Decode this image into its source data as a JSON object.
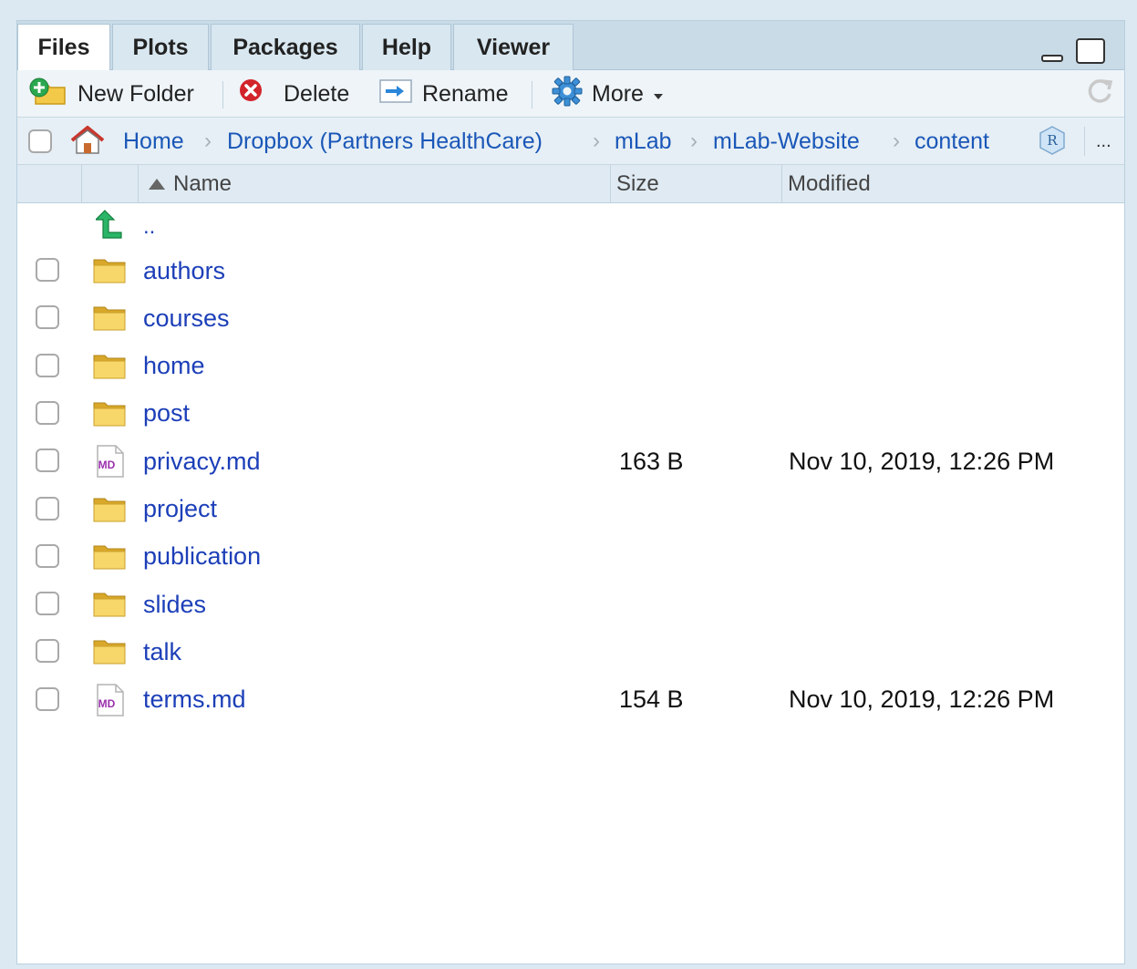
{
  "tabs": [
    {
      "label": "Files",
      "active": true
    },
    {
      "label": "Plots",
      "active": false
    },
    {
      "label": "Packages",
      "active": false
    },
    {
      "label": "Help",
      "active": false
    },
    {
      "label": "Viewer",
      "active": false
    }
  ],
  "toolbar": {
    "new_folder": "New Folder",
    "delete": "Delete",
    "rename": "Rename",
    "more": "More"
  },
  "breadcrumb": [
    "Home",
    "Dropbox (Partners HealthCare)",
    "mLab",
    "mLab-Website",
    "content"
  ],
  "breadcrumb_overflow": "...",
  "columns": {
    "name": "Name",
    "size": "Size",
    "modified": "Modified"
  },
  "parent_label": "..",
  "files": [
    {
      "name": "authors",
      "type": "folder",
      "size": "",
      "modified": ""
    },
    {
      "name": "courses",
      "type": "folder",
      "size": "",
      "modified": ""
    },
    {
      "name": "home",
      "type": "folder",
      "size": "",
      "modified": ""
    },
    {
      "name": "post",
      "type": "folder",
      "size": "",
      "modified": ""
    },
    {
      "name": "privacy.md",
      "type": "md",
      "size": "163 B",
      "modified": "Nov 10, 2019, 12:26 PM"
    },
    {
      "name": "project",
      "type": "folder",
      "size": "",
      "modified": ""
    },
    {
      "name": "publication",
      "type": "folder",
      "size": "",
      "modified": ""
    },
    {
      "name": "slides",
      "type": "folder",
      "size": "",
      "modified": ""
    },
    {
      "name": "talk",
      "type": "folder",
      "size": "",
      "modified": ""
    },
    {
      "name": "terms.md",
      "type": "md",
      "size": "154 B",
      "modified": "Nov 10, 2019, 12:26 PM"
    }
  ],
  "md_badge": "MD",
  "colors": {
    "link": "#1c3fb8",
    "crumb": "#1a57b8",
    "folder": "#f3c94a",
    "md_badge": "#9b2fae",
    "parent_arrow": "#22a85a"
  }
}
